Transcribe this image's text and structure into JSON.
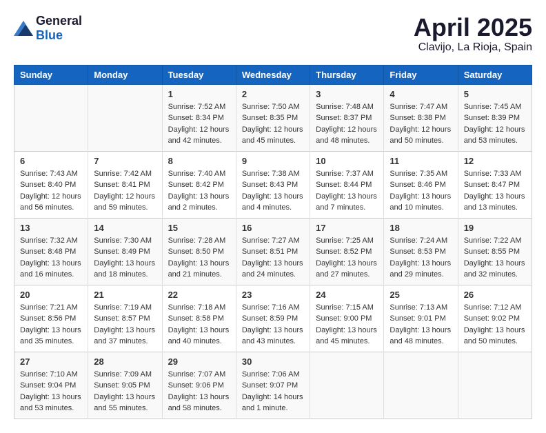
{
  "header": {
    "logo_general": "General",
    "logo_blue": "Blue",
    "month_year": "April 2025",
    "location": "Clavijo, La Rioja, Spain"
  },
  "days_of_week": [
    "Sunday",
    "Monday",
    "Tuesday",
    "Wednesday",
    "Thursday",
    "Friday",
    "Saturday"
  ],
  "weeks": [
    {
      "days": [
        {
          "number": "",
          "info": ""
        },
        {
          "number": "",
          "info": ""
        },
        {
          "number": "1",
          "info": "Sunrise: 7:52 AM\nSunset: 8:34 PM\nDaylight: 12 hours and 42 minutes."
        },
        {
          "number": "2",
          "info": "Sunrise: 7:50 AM\nSunset: 8:35 PM\nDaylight: 12 hours and 45 minutes."
        },
        {
          "number": "3",
          "info": "Sunrise: 7:48 AM\nSunset: 8:37 PM\nDaylight: 12 hours and 48 minutes."
        },
        {
          "number": "4",
          "info": "Sunrise: 7:47 AM\nSunset: 8:38 PM\nDaylight: 12 hours and 50 minutes."
        },
        {
          "number": "5",
          "info": "Sunrise: 7:45 AM\nSunset: 8:39 PM\nDaylight: 12 hours and 53 minutes."
        }
      ]
    },
    {
      "days": [
        {
          "number": "6",
          "info": "Sunrise: 7:43 AM\nSunset: 8:40 PM\nDaylight: 12 hours and 56 minutes."
        },
        {
          "number": "7",
          "info": "Sunrise: 7:42 AM\nSunset: 8:41 PM\nDaylight: 12 hours and 59 minutes."
        },
        {
          "number": "8",
          "info": "Sunrise: 7:40 AM\nSunset: 8:42 PM\nDaylight: 13 hours and 2 minutes."
        },
        {
          "number": "9",
          "info": "Sunrise: 7:38 AM\nSunset: 8:43 PM\nDaylight: 13 hours and 4 minutes."
        },
        {
          "number": "10",
          "info": "Sunrise: 7:37 AM\nSunset: 8:44 PM\nDaylight: 13 hours and 7 minutes."
        },
        {
          "number": "11",
          "info": "Sunrise: 7:35 AM\nSunset: 8:46 PM\nDaylight: 13 hours and 10 minutes."
        },
        {
          "number": "12",
          "info": "Sunrise: 7:33 AM\nSunset: 8:47 PM\nDaylight: 13 hours and 13 minutes."
        }
      ]
    },
    {
      "days": [
        {
          "number": "13",
          "info": "Sunrise: 7:32 AM\nSunset: 8:48 PM\nDaylight: 13 hours and 16 minutes."
        },
        {
          "number": "14",
          "info": "Sunrise: 7:30 AM\nSunset: 8:49 PM\nDaylight: 13 hours and 18 minutes."
        },
        {
          "number": "15",
          "info": "Sunrise: 7:28 AM\nSunset: 8:50 PM\nDaylight: 13 hours and 21 minutes."
        },
        {
          "number": "16",
          "info": "Sunrise: 7:27 AM\nSunset: 8:51 PM\nDaylight: 13 hours and 24 minutes."
        },
        {
          "number": "17",
          "info": "Sunrise: 7:25 AM\nSunset: 8:52 PM\nDaylight: 13 hours and 27 minutes."
        },
        {
          "number": "18",
          "info": "Sunrise: 7:24 AM\nSunset: 8:53 PM\nDaylight: 13 hours and 29 minutes."
        },
        {
          "number": "19",
          "info": "Sunrise: 7:22 AM\nSunset: 8:55 PM\nDaylight: 13 hours and 32 minutes."
        }
      ]
    },
    {
      "days": [
        {
          "number": "20",
          "info": "Sunrise: 7:21 AM\nSunset: 8:56 PM\nDaylight: 13 hours and 35 minutes."
        },
        {
          "number": "21",
          "info": "Sunrise: 7:19 AM\nSunset: 8:57 PM\nDaylight: 13 hours and 37 minutes."
        },
        {
          "number": "22",
          "info": "Sunrise: 7:18 AM\nSunset: 8:58 PM\nDaylight: 13 hours and 40 minutes."
        },
        {
          "number": "23",
          "info": "Sunrise: 7:16 AM\nSunset: 8:59 PM\nDaylight: 13 hours and 43 minutes."
        },
        {
          "number": "24",
          "info": "Sunrise: 7:15 AM\nSunset: 9:00 PM\nDaylight: 13 hours and 45 minutes."
        },
        {
          "number": "25",
          "info": "Sunrise: 7:13 AM\nSunset: 9:01 PM\nDaylight: 13 hours and 48 minutes."
        },
        {
          "number": "26",
          "info": "Sunrise: 7:12 AM\nSunset: 9:02 PM\nDaylight: 13 hours and 50 minutes."
        }
      ]
    },
    {
      "days": [
        {
          "number": "27",
          "info": "Sunrise: 7:10 AM\nSunset: 9:04 PM\nDaylight: 13 hours and 53 minutes."
        },
        {
          "number": "28",
          "info": "Sunrise: 7:09 AM\nSunset: 9:05 PM\nDaylight: 13 hours and 55 minutes."
        },
        {
          "number": "29",
          "info": "Sunrise: 7:07 AM\nSunset: 9:06 PM\nDaylight: 13 hours and 58 minutes."
        },
        {
          "number": "30",
          "info": "Sunrise: 7:06 AM\nSunset: 9:07 PM\nDaylight: 14 hours and 1 minute."
        },
        {
          "number": "",
          "info": ""
        },
        {
          "number": "",
          "info": ""
        },
        {
          "number": "",
          "info": ""
        }
      ]
    }
  ]
}
